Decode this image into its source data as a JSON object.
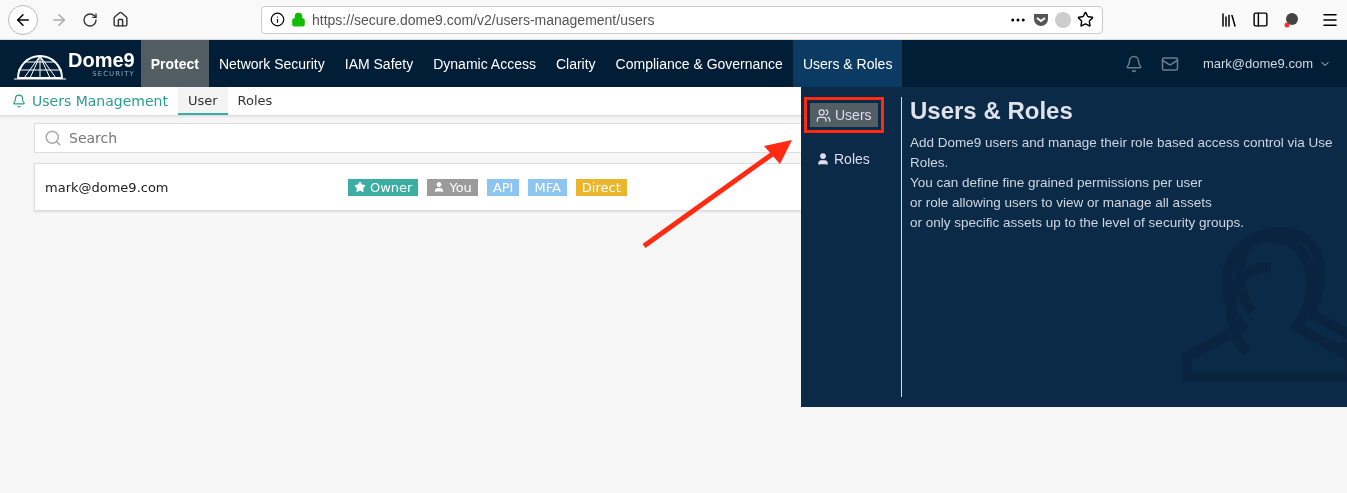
{
  "browser": {
    "url": "https://secure.dome9.com/v2/users-management/users",
    "forward_disabled": true
  },
  "logo": {
    "name": "Dome9",
    "tagline": "SECURITY"
  },
  "nav": [
    {
      "label": "Protect",
      "selected": true,
      "expanded": false
    },
    {
      "label": "Network Security",
      "selected": false,
      "expanded": false
    },
    {
      "label": "IAM Safety",
      "selected": false,
      "expanded": false
    },
    {
      "label": "Dynamic Access",
      "selected": false,
      "expanded": false
    },
    {
      "label": "Clarity",
      "selected": false,
      "expanded": false
    },
    {
      "label": "Compliance & Governance",
      "selected": false,
      "expanded": false
    },
    {
      "label": "Users & Roles",
      "selected": false,
      "expanded": true
    }
  ],
  "account": {
    "email": "mark@dome9.com"
  },
  "subnav": {
    "title": "Users Management",
    "tabs": [
      {
        "label": "User",
        "selected": true
      },
      {
        "label": "Roles",
        "selected": false
      }
    ]
  },
  "search": {
    "placeholder": "Search"
  },
  "users": [
    {
      "email": "mark@dome9.com",
      "tags": [
        {
          "label": "Owner",
          "kind": "star",
          "color": "#3aaea3"
        },
        {
          "label": "You",
          "kind": "person",
          "color": "#9b9b9b"
        },
        {
          "label": "API",
          "kind": "plain",
          "color": "#8ec5f0"
        },
        {
          "label": "MFA",
          "kind": "plain",
          "color": "#8ec5f0"
        },
        {
          "label": "Direct",
          "kind": "plain",
          "color": "#ecb52e"
        }
      ]
    }
  ],
  "dropdown": {
    "items": [
      {
        "label": "Users",
        "kind": "users",
        "selected": true,
        "highlighted": true
      },
      {
        "label": "Roles",
        "kind": "role",
        "selected": false,
        "highlighted": false
      }
    ],
    "title": "Users & Roles",
    "lines": [
      "Add Dome9 users and manage their role based access control via Use",
      "Roles.",
      "You can define fine grained permissions per user",
      "or role allowing users to view or manage all assets",
      "or only specific assets up to the level of security groups."
    ]
  },
  "annotation": {
    "arrow": true
  }
}
